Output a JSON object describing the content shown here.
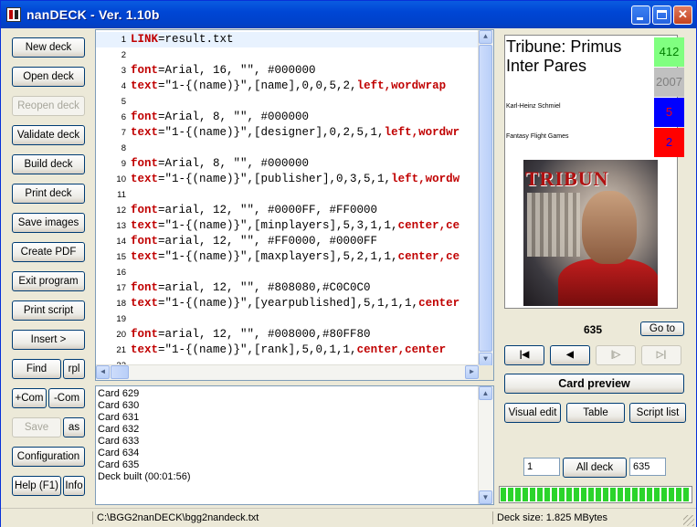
{
  "window": {
    "title": "nanDECK - Ver. 1.10b"
  },
  "sidebar": {
    "new_deck": "New deck",
    "open_deck": "Open deck",
    "reopen_deck": "Reopen deck",
    "validate_deck": "Validate deck",
    "build_deck": "Build deck",
    "print_deck": "Print deck",
    "save_images": "Save images",
    "create_pdf": "Create PDF",
    "exit_program": "Exit program",
    "print_script": "Print script",
    "insert": "Insert >",
    "find": "Find",
    "rpl": "rpl",
    "add_com": "+Com",
    "remove_com": "-Com",
    "save": "Save",
    "save_as": "as",
    "configuration": "Configuration",
    "help": "Help (F1)",
    "info": "Info"
  },
  "editor": {
    "lines": [
      {
        "n": "1",
        "kw": "LINK",
        "rest": "=result.txt",
        "tail": ""
      },
      {
        "n": "2",
        "kw": "",
        "rest": "",
        "tail": ""
      },
      {
        "n": "3",
        "kw": "font",
        "rest": "=Arial, 16, \"\", #000000",
        "tail": ""
      },
      {
        "n": "4",
        "kw": "text",
        "rest": "=\"1-{(name)}\",[name],0,0,5,2,",
        "tail": "left,wordwrap"
      },
      {
        "n": "5",
        "kw": "",
        "rest": "",
        "tail": ""
      },
      {
        "n": "6",
        "kw": "font",
        "rest": "=Arial, 8, \"\", #000000",
        "tail": ""
      },
      {
        "n": "7",
        "kw": "text",
        "rest": "=\"1-{(name)}\",[designer],0,2,5,1,",
        "tail": "left,wordwr"
      },
      {
        "n": "8",
        "kw": "",
        "rest": "",
        "tail": ""
      },
      {
        "n": "9",
        "kw": "font",
        "rest": "=Arial, 8, \"\", #000000",
        "tail": ""
      },
      {
        "n": "10",
        "kw": "text",
        "rest": "=\"1-{(name)}\",[publisher],0,3,5,1,",
        "tail": "left,wordw"
      },
      {
        "n": "11",
        "kw": "",
        "rest": "",
        "tail": ""
      },
      {
        "n": "12",
        "kw": "font",
        "rest": "=arial, 12, \"\", #0000FF, #FF0000",
        "tail": ""
      },
      {
        "n": "13",
        "kw": "text",
        "rest": "=\"1-{(name)}\",[minplayers],5,3,1,1,",
        "tail": "center,ce"
      },
      {
        "n": "14",
        "kw": "font",
        "rest": "=arial, 12, \"\", #FF0000, #0000FF",
        "tail": ""
      },
      {
        "n": "15",
        "kw": "text",
        "rest": "=\"1-{(name)}\",[maxplayers],5,2,1,1,",
        "tail": "center,ce"
      },
      {
        "n": "16",
        "kw": "",
        "rest": "",
        "tail": ""
      },
      {
        "n": "17",
        "kw": "font",
        "rest": "=arial, 12, \"\", #808080,#C0C0C0",
        "tail": ""
      },
      {
        "n": "18",
        "kw": "text",
        "rest": "=\"1-{(name)}\",[yearpublished],5,1,1,1,",
        "tail": "center"
      },
      {
        "n": "19",
        "kw": "",
        "rest": "",
        "tail": ""
      },
      {
        "n": "20",
        "kw": "font",
        "rest": "=arial, 12, \"\", #008000,#80FF80",
        "tail": ""
      },
      {
        "n": "21",
        "kw": "text",
        "rest": "=\"1-{(name)}\",[rank],5,0,1,1,",
        "tail": "center,center"
      },
      {
        "n": "22",
        "kw": "",
        "rest": "",
        "tail": ""
      }
    ]
  },
  "log": {
    "lines": [
      "Card 629",
      "Card 630",
      "Card 631",
      "Card 632",
      "Card 633",
      "Card 634",
      "Card 635",
      "Deck built (00:01:56)"
    ]
  },
  "card": {
    "name": "Tribune: Primus Inter Pares",
    "designer": "Karl-Heinz Schmiel",
    "publisher": "Fantasy Flight Games",
    "rank": "412",
    "year": "2007",
    "maxplayers": "5",
    "minplayers": "2",
    "art_title": "TRIBUN",
    "colors": {
      "rank_bg": "#80ff80",
      "year_bg": "#c0c0c0",
      "maxp_bg": "#0000ff",
      "minp_bg": "#ff0000"
    }
  },
  "preview": {
    "card_number": "635",
    "goto": "Go to",
    "first": "|◀",
    "prev": "◀",
    "next": "|▷",
    "last": "▷|",
    "card_preview": "Card preview",
    "visual_edit": "Visual edit",
    "table": "Table",
    "script_list": "Script list",
    "range_from": "1",
    "all_deck": "All deck",
    "range_to": "635",
    "progress": 1.0
  },
  "status": {
    "path": "C:\\BGG2nanDECK\\bgg2nandeck.txt",
    "deck_size": "Deck size: 1.825 MBytes"
  }
}
